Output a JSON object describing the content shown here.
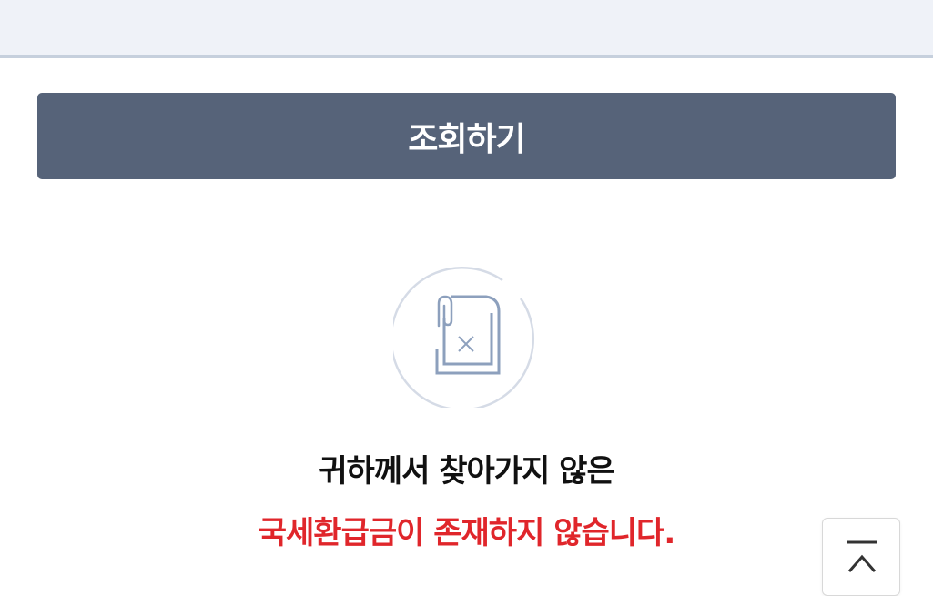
{
  "query_button": {
    "label": "조회하기"
  },
  "empty_state": {
    "icon": "document-x-paperclip-icon",
    "message_line_1": "귀하께서 찾아가지 않은",
    "message_line_2": "국세환급금이 존재하지 않습니다."
  },
  "scroll_top": {
    "icon": "arrow-up-to-top-icon"
  },
  "colors": {
    "top_panel_background": "#eff2f8",
    "button_background": "#566379",
    "highlight_text": "#e0262b",
    "illustration_stroke": "#8da0bd"
  }
}
